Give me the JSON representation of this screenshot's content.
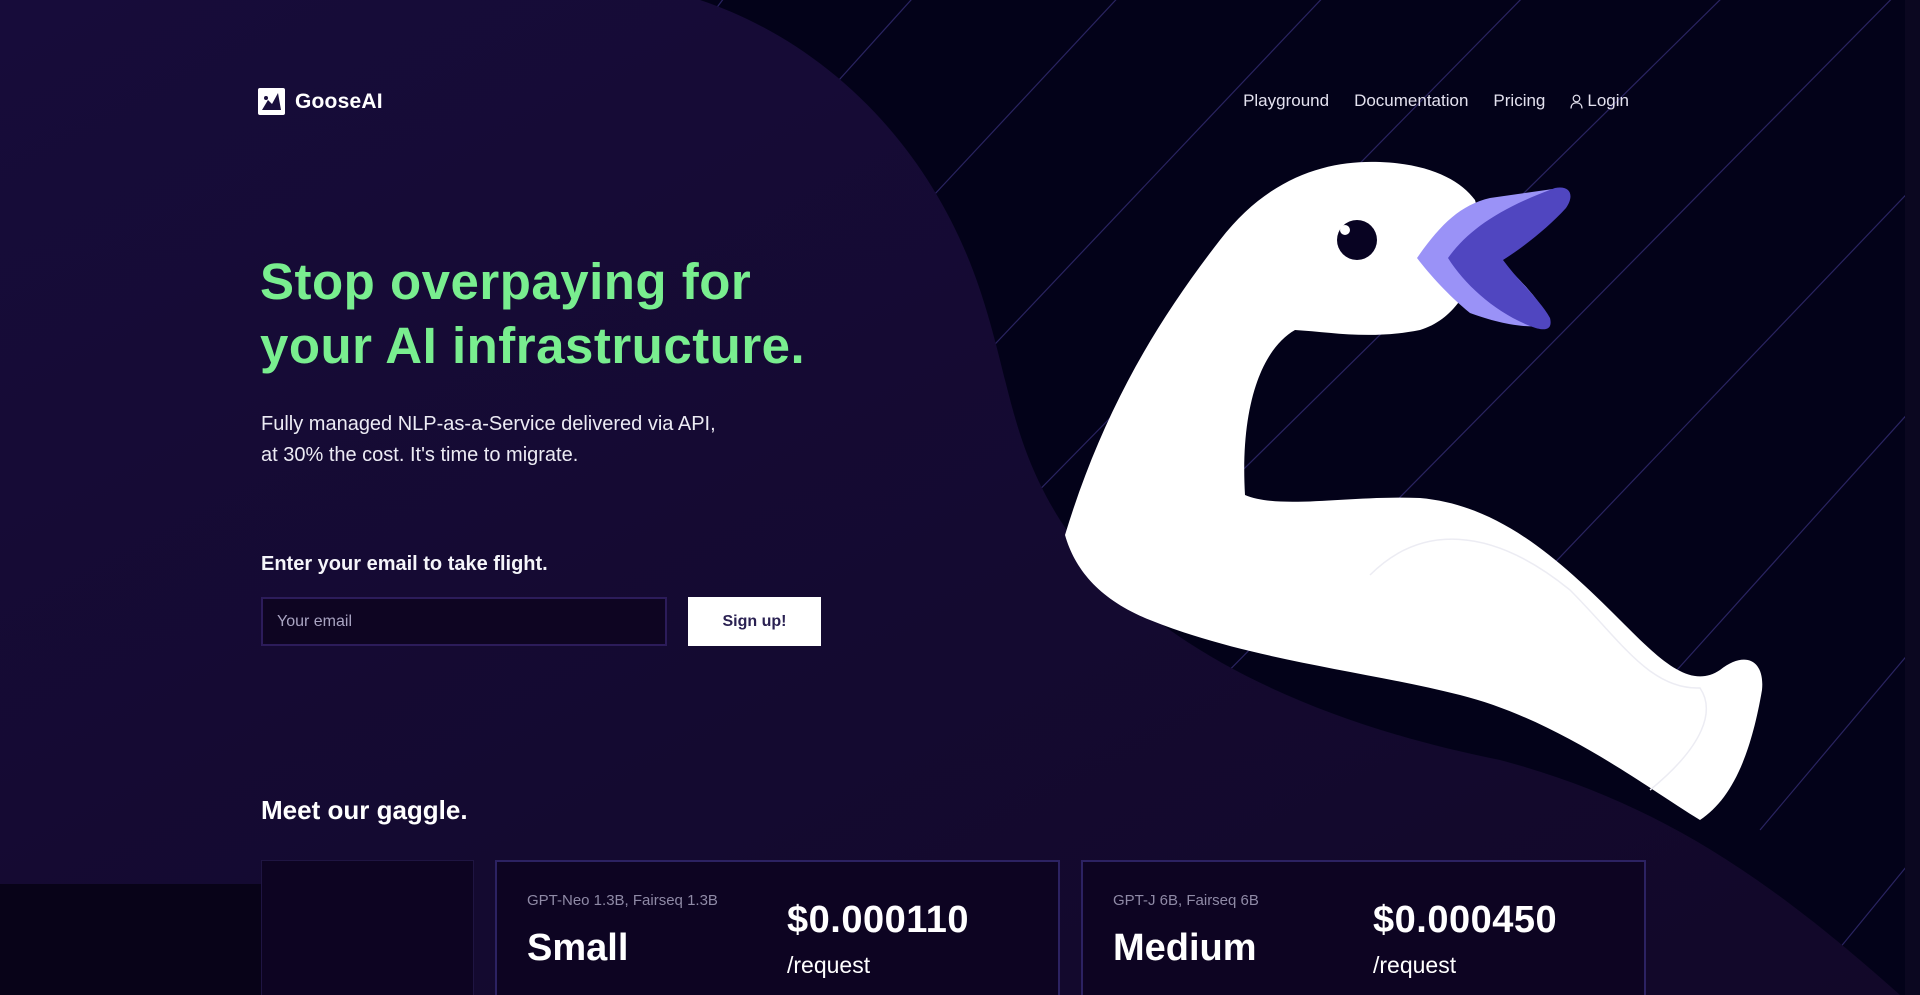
{
  "brand": {
    "name": "GooseAI",
    "logo_icon": "goose-logo-icon"
  },
  "nav": {
    "links": [
      {
        "label": "Playground"
      },
      {
        "label": "Documentation"
      },
      {
        "label": "Pricing"
      },
      {
        "label": "Login",
        "icon": "user-icon"
      }
    ]
  },
  "hero": {
    "title_line1": "Stop overpaying for",
    "title_line2": "your AI infrastructure.",
    "subtitle_line1": "Fully managed NLP-as-a-Service delivered via API,",
    "subtitle_line2": "at 30% the cost. It's time to migrate."
  },
  "signup": {
    "label": "Enter your email to take flight.",
    "email_placeholder": "Your email",
    "email_value": "",
    "button_label": "Sign up!"
  },
  "gaggle": {
    "title": "Meet our gaggle.",
    "cards": [
      {
        "models": "GPT-Neo 1.3B, Fairseq 1.3B",
        "tier": "Small",
        "price": "$0.000110",
        "unit": "/request"
      },
      {
        "models": "GPT-J 6B, Fairseq 6B",
        "tier": "Medium",
        "price": "$0.000450",
        "unit": "/request"
      }
    ]
  },
  "colors": {
    "background_dark": "#030219",
    "panel_purple": "#1a0f3d",
    "accent_green": "#79ee8f",
    "beak_light": "#9a92f7",
    "beak_dark": "#5046c0",
    "stripe": "#2a2461"
  },
  "illustration": {
    "subject": "white goose with purple beak",
    "icon": "goose-illustration"
  }
}
